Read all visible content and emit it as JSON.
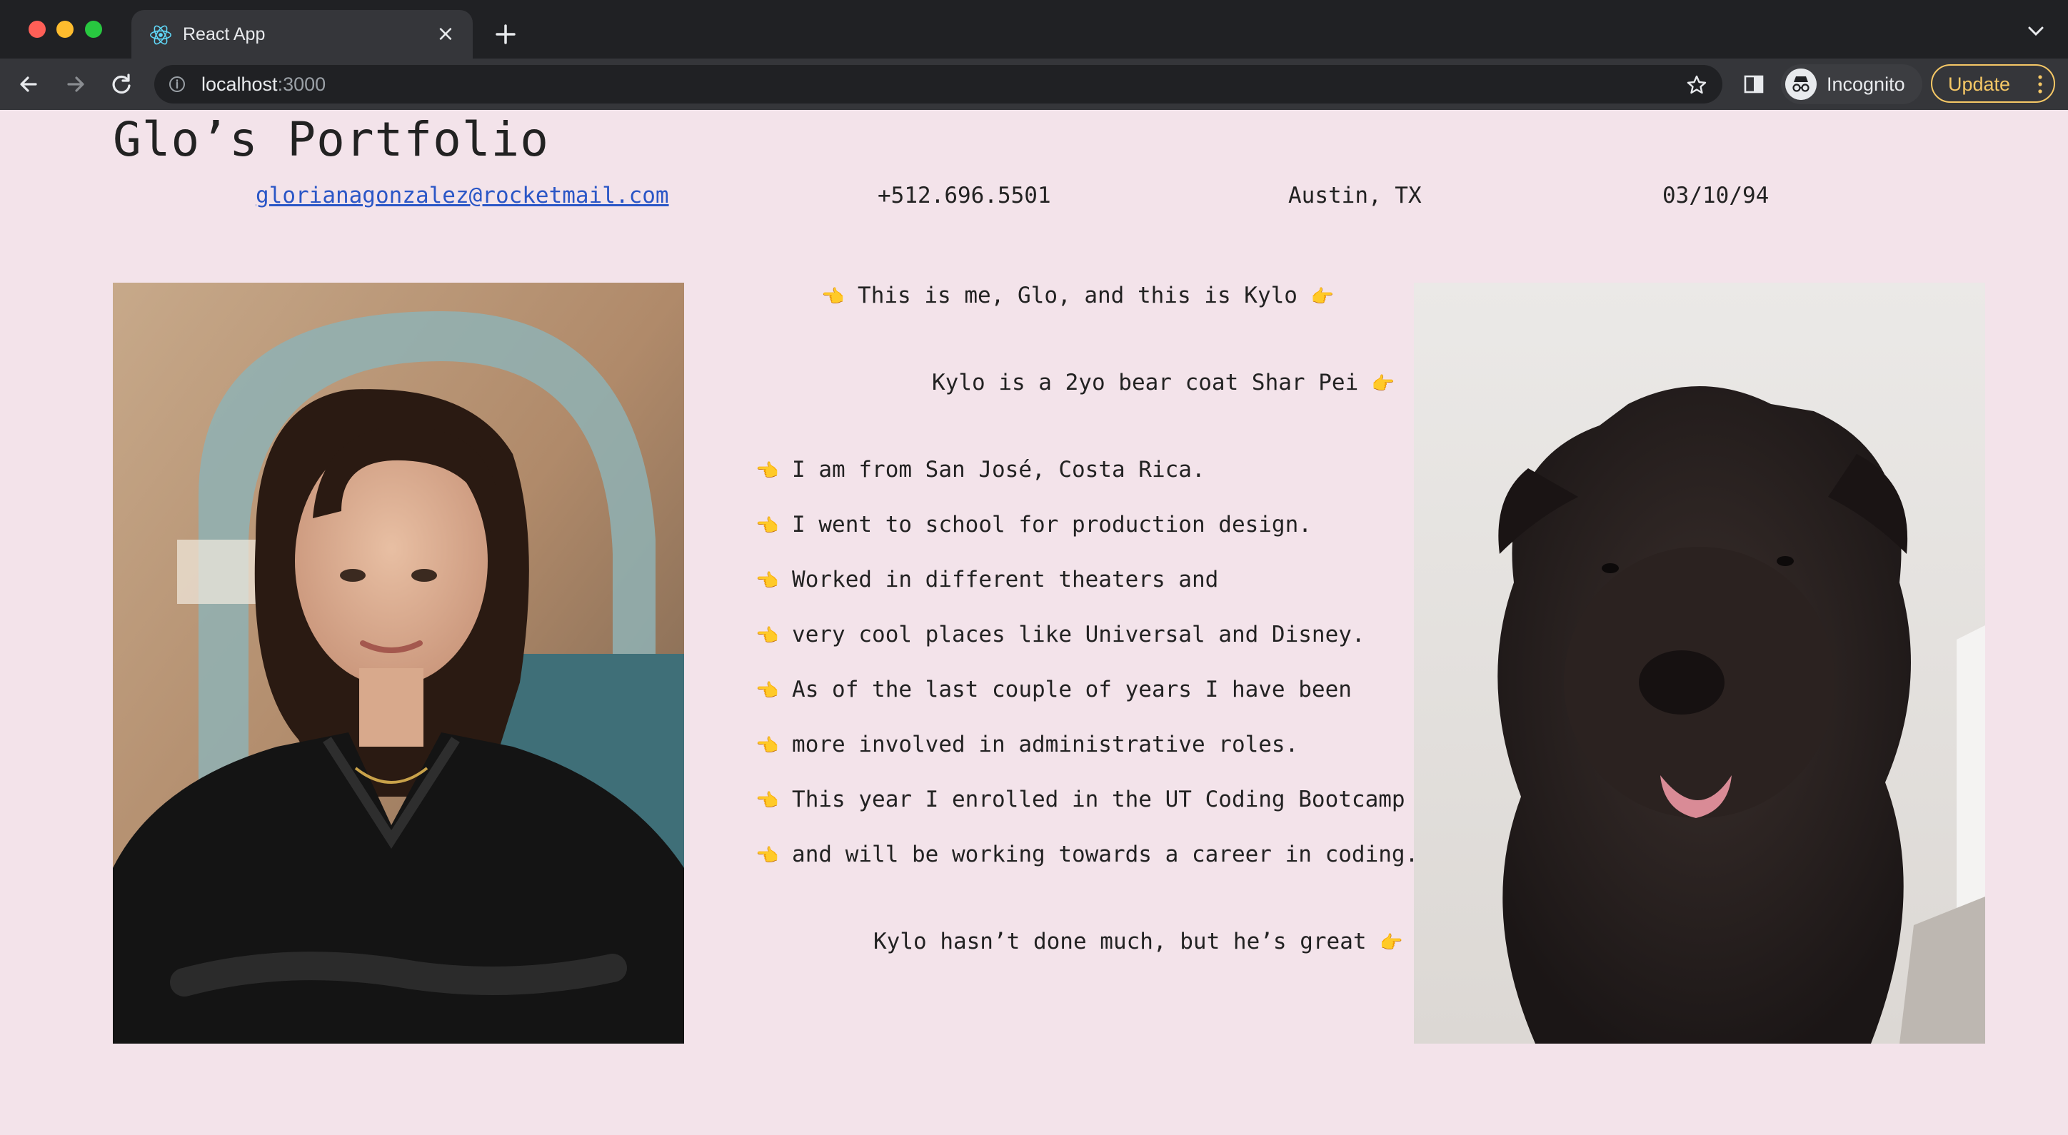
{
  "browser": {
    "tab_title": "React App",
    "url_host": "localhost",
    "url_port": ":3000",
    "profile_label": "Incognito",
    "update_label": "Update",
    "icons": [
      "react-logo-icon",
      "close-icon",
      "plus-icon",
      "chevron-down-icon",
      "back-icon",
      "forward-icon",
      "reload-icon",
      "info-icon",
      "star-icon",
      "side-panel-icon",
      "incognito-icon",
      "kebab-menu-icon"
    ]
  },
  "page": {
    "title": "Glo’s Portfolio",
    "contact": {
      "email": "glorianagonzalez@rocketmail.com",
      "phone": "+512.696.5501",
      "location": "Austin, TX",
      "birthdate": "03/10/94"
    },
    "intro": {
      "left_hand": "👈",
      "text": "This is me, Glo, and this is Kylo",
      "right_hand": "👉"
    },
    "kylo_breed": {
      "text": "Kylo is a 2yo bear coat Shar Pei",
      "hand": "👉"
    },
    "about_glo": [
      {
        "hand": "👈",
        "text": "I am from San José, Costa Rica."
      },
      {
        "hand": "👈",
        "text": "I went to school for production design."
      },
      {
        "hand": "👈",
        "text": "Worked in different theaters and"
      },
      {
        "hand": "👈",
        "text": "very cool places like Universal and Disney."
      },
      {
        "hand": "👈",
        "text": "As of the last couple of years I have been"
      },
      {
        "hand": "👈",
        "text": "more involved in administrative roles."
      },
      {
        "hand": "👈",
        "text": "This year I enrolled in the UT Coding Bootcamp"
      },
      {
        "hand": "👈",
        "text": "and will be working towards a career in coding."
      }
    ],
    "kylo_note": {
      "text": "Kylo hasn’t done much, but he’s great",
      "hand": "👉"
    }
  },
  "colors": {
    "page_background": "#f3e3ea",
    "link": "#2a56c6",
    "text": "#222222",
    "chrome_dark": "#202124",
    "chrome_tab": "#35363a",
    "update_accent": "#f6c866"
  }
}
